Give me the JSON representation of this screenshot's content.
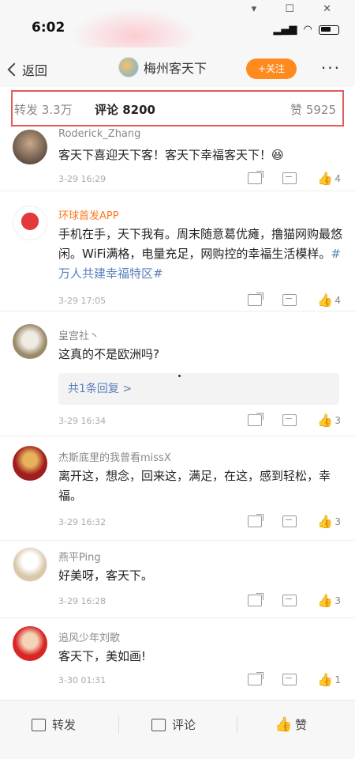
{
  "status": {
    "time": "6:02"
  },
  "nav": {
    "back_label": "返回",
    "title": "梅州客天下",
    "follow_label": "+关注",
    "more_label": "···"
  },
  "tabs": {
    "repost": "转发 3.3万",
    "comment": "评论 8200",
    "like": "赞 5925"
  },
  "comments": [
    {
      "name": "Roderick_Zhang",
      "text": "客天下喜迎天下客！客天下幸福客天下！😆",
      "time": "3-29 16:29",
      "likes": "4"
    },
    {
      "name": "环球首发APP",
      "text_parts": [
        "手机在手，天下我有。周末随意葛优瘫，撸猫网购最悠闲。WiFi满格，电量充足，网购控的幸福生活模样。",
        "#万人共建幸福特区#"
      ],
      "time": "3-29 17:05",
      "likes": "4"
    },
    {
      "name": "皇宫社丶",
      "text": "这真的不是欧洲吗?",
      "reply": "共1条回复 >",
      "time": "3-29 16:34",
      "likes": "3"
    },
    {
      "name": "杰斯底里的我曾看missX",
      "text": "离开这，想念，回来这，满足，在这，感到轻松，幸福。",
      "time": "3-29 16:32",
      "likes": "3"
    },
    {
      "name": "燕平Ping",
      "text": "好美呀，客天下。",
      "time": "3-29 16:28",
      "likes": "3"
    },
    {
      "name": "追风少年刘歌",
      "text": "客天下，美如画!",
      "time": "3-30 01:31",
      "likes": "1"
    }
  ],
  "bottom": {
    "repost": "转发",
    "comment": "评论",
    "like": "赞"
  },
  "colors": {
    "accent": "#ff8a1e",
    "link": "#5b7fbd",
    "highlight_border": "#e35b5b"
  }
}
